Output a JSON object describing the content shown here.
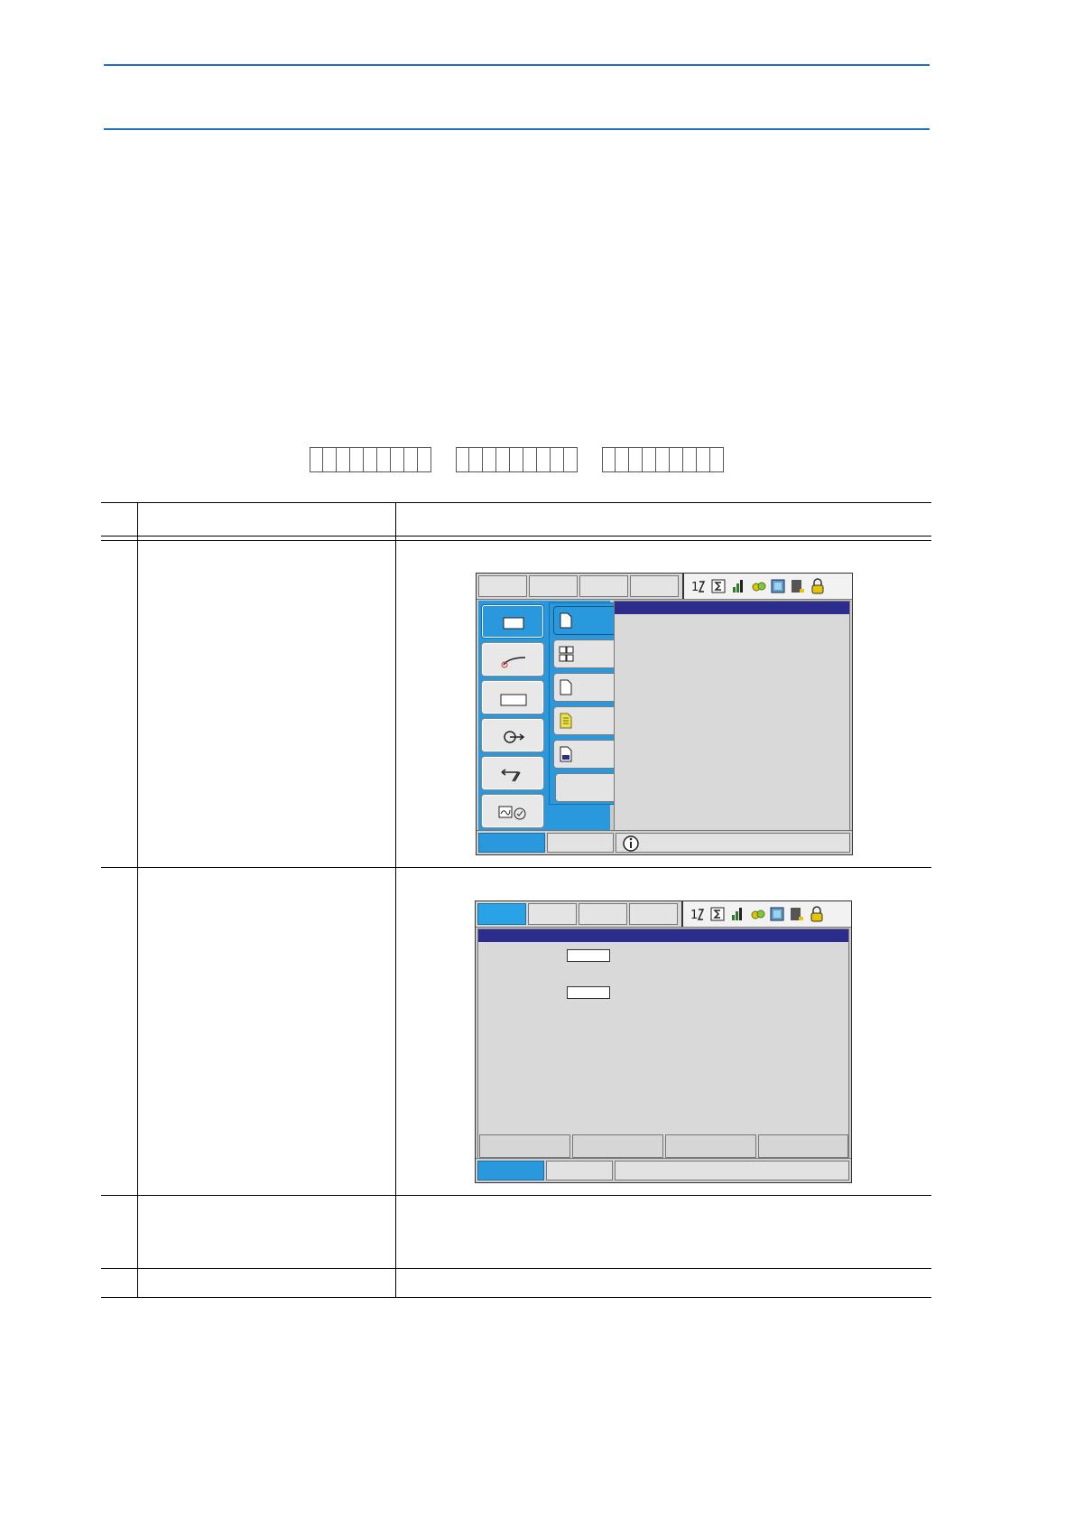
{
  "page": {
    "step_table": {
      "rows": [
        {
          "id": "row-1"
        },
        {
          "id": "row-2"
        },
        {
          "id": "row-3"
        },
        {
          "id": "row-4"
        }
      ]
    },
    "screen1": {
      "main_menu_icons": [
        "job-icon",
        "arc-welding-icon",
        "variable-icon",
        "in-out-icon",
        "robot-icon",
        "system-info-icon"
      ],
      "submenu_icons": [
        "job-document-icon",
        "select-job-icon",
        "create-job-icon",
        "master-job-icon",
        "job-capacity-icon"
      ],
      "status_icons": [
        "coordinate-icon",
        "sum-icon",
        "speed-icon",
        "cycle-icon",
        "teach-icon",
        "security-icon",
        "lock-icon"
      ],
      "info_icon": "info-icon"
    },
    "screen2": {
      "status_icons": [
        "coordinate-icon",
        "sum-icon",
        "speed-icon",
        "cycle-icon",
        "teach-icon",
        "security-icon",
        "lock-icon"
      ]
    }
  },
  "colors": {
    "rule": "#1f6fc2",
    "menu_blue": "#2a98dc",
    "title_bar": "#2c2c8c",
    "screen_gray": "#d9d9d9"
  }
}
